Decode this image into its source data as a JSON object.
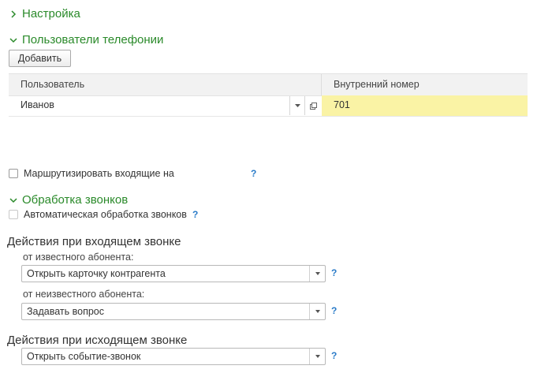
{
  "sections": {
    "settings": {
      "title": "Настройка",
      "expanded": false
    },
    "telephony_users": {
      "title": "Пользователи телефонии",
      "expanded": true
    },
    "call_processing": {
      "title": "Обработка звонков",
      "expanded": true
    }
  },
  "toolbar": {
    "add_label": "Добавить"
  },
  "users_table": {
    "columns": [
      "Пользователь",
      "Внутренний номер"
    ],
    "rows": [
      {
        "user": "Иванов",
        "extension": "701"
      }
    ]
  },
  "route_incoming": {
    "label": "Маршрутизировать входящие на",
    "checked": false,
    "help": "?"
  },
  "auto_processing": {
    "label": "Автоматическая обработка звонков",
    "checked": false,
    "help": "?"
  },
  "incoming": {
    "heading": "Действия при входящем звонке",
    "known_label": "от известного абонента:",
    "known_value": "Открыть карточку контрагента",
    "unknown_label": "от неизвестного абонента:",
    "unknown_value": "Задавать вопрос",
    "help": "?"
  },
  "outgoing": {
    "heading": "Действия при исходящем звонке",
    "value": "Открыть событие-звонок",
    "help": "?"
  },
  "colors": {
    "section_green": "#2a8a2a",
    "help_blue": "#2a7bc8",
    "highlight_yellow": "#faf3a5"
  },
  "icons": [
    "chevron-right-icon",
    "chevron-down-icon",
    "dropdown-arrow-icon",
    "open-form-icon"
  ]
}
